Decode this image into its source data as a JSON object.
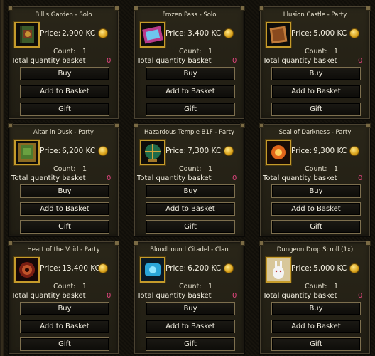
{
  "labels": {
    "price": "Price:",
    "count": "Count:",
    "total": "Total quantity basket",
    "buy": "Buy",
    "add": "Add to Basket",
    "gift": "Gift",
    "coin": "KC"
  },
  "items": [
    {
      "title": "Bill's Garden - Solo",
      "price": "2,900 KC",
      "count": "1",
      "total": "0",
      "icon": "book-icon"
    },
    {
      "title": "Frozen Pass - Solo",
      "price": "3,400 KC",
      "count": "1",
      "total": "0",
      "icon": "crystal-scroll-icon"
    },
    {
      "title": "Illusion Castle - Party",
      "price": "5,000 KC",
      "count": "1",
      "total": "0",
      "icon": "parchment-icon"
    },
    {
      "title": "Altar in Dusk - Party",
      "price": "6,200 KC",
      "count": "1",
      "total": "0",
      "icon": "framed-map-icon"
    },
    {
      "title": "Hazardous Temple B1F - Party",
      "price": "7,300 KC",
      "count": "1",
      "total": "0",
      "icon": "globe-icon"
    },
    {
      "title": "Seal of Darkness - Party",
      "price": "9,300 KC",
      "count": "1",
      "total": "0",
      "icon": "fire-orb-icon"
    },
    {
      "title": "Heart of the Void - Party",
      "price": "13,400 KC",
      "count": "1",
      "total": "0",
      "icon": "void-orb-icon"
    },
    {
      "title": "Bloodbound Citadel - Clan",
      "price": "6,200 KC",
      "count": "1",
      "total": "0",
      "icon": "blue-rune-icon"
    },
    {
      "title": "Dungeon Drop Scroll (1x)",
      "price": "5,000 KC",
      "count": "1",
      "total": "0",
      "icon": "rabbit-icon"
    }
  ]
}
